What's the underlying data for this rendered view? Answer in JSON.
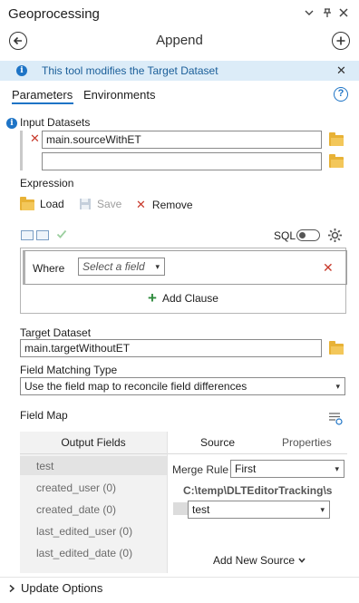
{
  "window": {
    "title": "Geoprocessing"
  },
  "titlebar_icons": [
    "chevron-down-icon",
    "pin-icon",
    "close-icon"
  ],
  "nav": {
    "tool_title": "Append"
  },
  "banner": {
    "text": "This tool modifies the Target Dataset",
    "close_glyph": "✕"
  },
  "tabs": [
    {
      "label": "Parameters",
      "active": true
    },
    {
      "label": "Environments",
      "active": false
    }
  ],
  "help_glyph": "?",
  "input_datasets": {
    "label": "Input Datasets",
    "items": [
      "main.sourceWithET",
      ""
    ]
  },
  "expression": {
    "label": "Expression",
    "load_label": "Load",
    "save_label": "Save",
    "remove_label": "Remove",
    "sql_label": "SQL",
    "sql_on": false
  },
  "where_clause": {
    "where_label": "Where",
    "field_placeholder": "Select a field",
    "add_clause_label": "Add Clause"
  },
  "target_dataset": {
    "label": "Target Dataset",
    "value": "main.targetWithoutET"
  },
  "field_matching": {
    "label": "Field Matching Type",
    "value": "Use the field map to reconcile field differences"
  },
  "field_map": {
    "label": "Field Map",
    "output_fields_header": "Output Fields",
    "source_tab": "Source",
    "properties_tab": "Properties",
    "output_fields": [
      {
        "label": "test",
        "selected": true
      },
      {
        "label": "created_user  (0)",
        "selected": false
      },
      {
        "label": "created_date  (0)",
        "selected": false
      },
      {
        "label": "last_edited_user  (0)",
        "selected": false
      },
      {
        "label": "last_edited_date  (0)",
        "selected": false
      }
    ],
    "merge_rule_label": "Merge Rule",
    "merge_rule_value": "First",
    "source_path": "C:\\temp\\DLTEditorTracking\\s",
    "source_field_value": "test",
    "add_new_source_label": "Add New Source"
  },
  "update_options": {
    "label": "Update Options"
  },
  "colors": {
    "accent": "#1e74c6",
    "banner_bg": "#dcecf8",
    "remove_red": "#c8392b",
    "add_green": "#2e8b3d"
  }
}
